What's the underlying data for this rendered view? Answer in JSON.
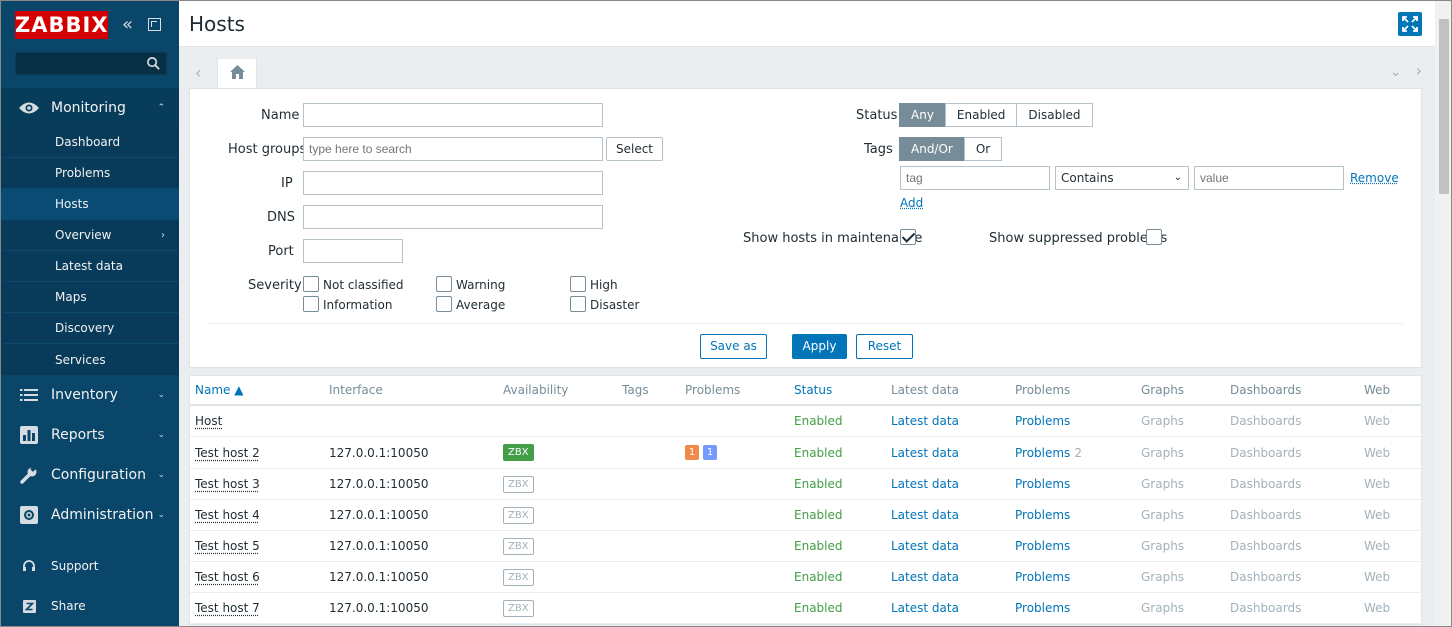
{
  "sidebar": {
    "logo": "ZABBIX",
    "search_placeholder": "",
    "monitoring": {
      "label": "Monitoring",
      "items": [
        {
          "label": "Dashboard"
        },
        {
          "label": "Problems"
        },
        {
          "label": "Hosts",
          "active": true
        },
        {
          "label": "Overview"
        },
        {
          "label": "Latest data"
        },
        {
          "label": "Maps"
        },
        {
          "label": "Discovery"
        },
        {
          "label": "Services"
        }
      ]
    },
    "inventory": "Inventory",
    "reports": "Reports",
    "configuration": "Configuration",
    "administration": "Administration",
    "support": "Support",
    "share": "Share"
  },
  "header": {
    "title": "Hosts"
  },
  "filter": {
    "name_label": "Name",
    "name_value": "",
    "hostgroups_label": "Host groups",
    "hostgroups_placeholder": "type here to search",
    "select_label": "Select",
    "ip_label": "IP",
    "dns_label": "DNS",
    "port_label": "Port",
    "severity_label": "Severity",
    "severities": {
      "not_classified": "Not classified",
      "warning": "Warning",
      "high": "High",
      "information": "Information",
      "average": "Average",
      "disaster": "Disaster"
    },
    "status_label": "Status",
    "status_options": [
      "Any",
      "Enabled",
      "Disabled"
    ],
    "status_selected": "Any",
    "tags_label": "Tags",
    "tags_options": [
      "And/Or",
      "Or"
    ],
    "tags_selected": "And/Or",
    "tag_placeholder": "tag",
    "tag_operator": "Contains",
    "value_placeholder": "value",
    "remove_label": "Remove",
    "add_label": "Add",
    "maintenance_label": "Show hosts in maintenance",
    "maintenance_checked": true,
    "suppressed_label": "Show suppressed problems",
    "suppressed_checked": false,
    "save_as_label": "Save as",
    "apply_label": "Apply",
    "reset_label": "Reset"
  },
  "table": {
    "headers": {
      "name": "Name ▲",
      "interface": "Interface",
      "availability": "Availability",
      "tags": "Tags",
      "problems": "Problems",
      "status": "Status",
      "latest_data": "Latest data",
      "problems2": "Problems",
      "graphs": "Graphs",
      "dashboards": "Dashboards",
      "web": "Web"
    },
    "rows": [
      {
        "name": "Host",
        "interface": "",
        "zbx": "",
        "status": "Enabled",
        "latest": "Latest data",
        "problems": "Problems",
        "problems_count": "",
        "graphs": "Graphs",
        "dashboards": "Dashboards",
        "web": "Web"
      },
      {
        "name": "Test host 2",
        "interface": "127.0.0.1:10050",
        "zbx": "ZBX",
        "zbx_active": true,
        "p1": "1",
        "p2": "1",
        "status": "Enabled",
        "latest": "Latest data",
        "problems": "Problems",
        "problems_count": "2",
        "graphs": "Graphs",
        "dashboards": "Dashboards",
        "web": "Web"
      },
      {
        "name": "Test host 3",
        "interface": "127.0.0.1:10050",
        "zbx": "ZBX",
        "status": "Enabled",
        "latest": "Latest data",
        "problems": "Problems",
        "problems_count": "",
        "graphs": "Graphs",
        "dashboards": "Dashboards",
        "web": "Web"
      },
      {
        "name": "Test host 4",
        "interface": "127.0.0.1:10050",
        "zbx": "ZBX",
        "status": "Enabled",
        "latest": "Latest data",
        "problems": "Problems",
        "problems_count": "",
        "graphs": "Graphs",
        "dashboards": "Dashboards",
        "web": "Web"
      },
      {
        "name": "Test host 5",
        "interface": "127.0.0.1:10050",
        "zbx": "ZBX",
        "status": "Enabled",
        "latest": "Latest data",
        "problems": "Problems",
        "problems_count": "",
        "graphs": "Graphs",
        "dashboards": "Dashboards",
        "web": "Web"
      },
      {
        "name": "Test host 6",
        "interface": "127.0.0.1:10050",
        "zbx": "ZBX",
        "status": "Enabled",
        "latest": "Latest data",
        "problems": "Problems",
        "problems_count": "",
        "graphs": "Graphs",
        "dashboards": "Dashboards",
        "web": "Web"
      },
      {
        "name": "Test host 7",
        "interface": "127.0.0.1:10050",
        "zbx": "ZBX",
        "status": "Enabled",
        "latest": "Latest data",
        "problems": "Problems",
        "problems_count": "",
        "graphs": "Graphs",
        "dashboards": "Dashboards",
        "web": "Web"
      }
    ]
  },
  "colors": {
    "sidebar": "#0a466a",
    "logo_red": "#d40000",
    "link_blue": "#0275b8",
    "enabled_green": "#429e47",
    "problem_orange": "#f0894a",
    "problem_blue": "#7499ff"
  }
}
